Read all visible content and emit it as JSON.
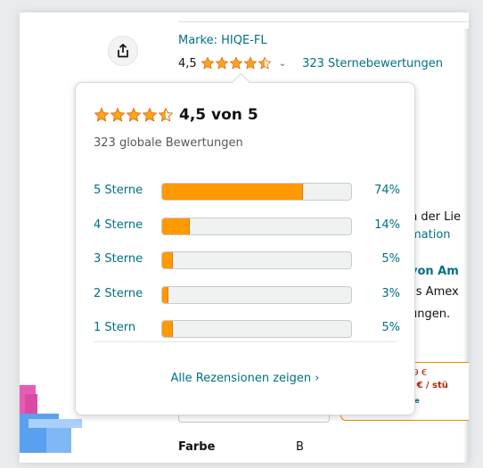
{
  "product": {
    "brand": "Marke: HIQE-FL",
    "rating_value": "4,5",
    "rating_count_link": "323 Sternebewertungen",
    "rating_stars": 4.5,
    "share_icon": "share-icon"
  },
  "background": {
    "line1": "n der Lie",
    "line2": "mation",
    "line3": "von Am",
    "line4": "ss Amex",
    "line5": "ungen.",
    "price_line1": "99 €",
    "price_line2": "5 € / stü",
    "price_line3": "me",
    "farbe_label": "Farbe",
    "farbe_value": "B"
  },
  "popover": {
    "stars": 4.5,
    "rating_text": "4,5 von 5",
    "global_count": "323 globale Bewertungen",
    "histogram": [
      {
        "label": "5 Sterne",
        "percent_text": "74%",
        "percent": 74
      },
      {
        "label": "4 Sterne",
        "percent_text": "14%",
        "percent": 14
      },
      {
        "label": "3 Sterne",
        "percent_text": "5%",
        "percent": 5
      },
      {
        "label": "2 Sterne",
        "percent_text": "3%",
        "percent": 3
      },
      {
        "label": "1 Stern",
        "percent_text": "5%",
        "percent": 5
      }
    ],
    "all_reviews_link": "Alle Rezensionen zeigen ›"
  },
  "colors": {
    "star": "#ffa41c",
    "bar_fill": "#ff9900",
    "link": "#007185"
  }
}
